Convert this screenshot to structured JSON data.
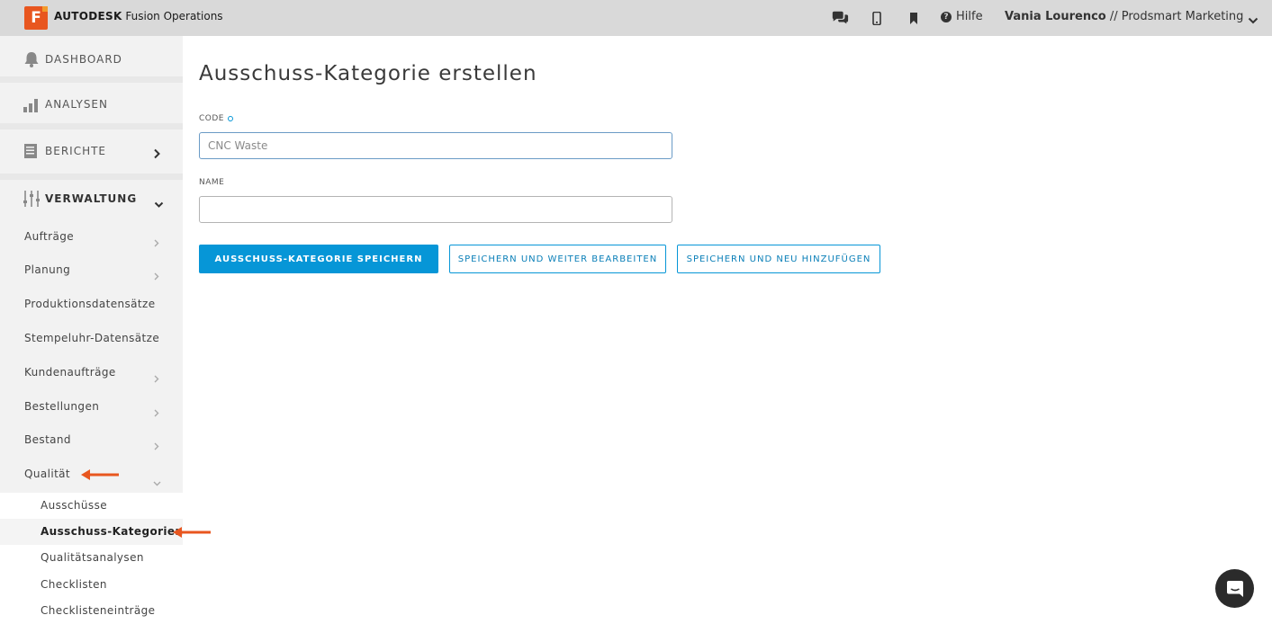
{
  "header": {
    "logo_letter": "F",
    "brand_strong": "AUTODESK",
    "brand_rest": " Fusion Operations",
    "icons": [
      "comments-icon",
      "mobile-icon",
      "bookmark-icon"
    ],
    "help_label": "Hilfe",
    "user_name": "Vania Lourenco",
    "user_separator": " // ",
    "user_company": "Prodsmart Marketing"
  },
  "sidebar": {
    "main_items": [
      {
        "label": "DASHBOARD",
        "icon": "bell-icon"
      },
      {
        "label": "ANALYSEN",
        "icon": "bar-chart-icon"
      },
      {
        "label": "BERICHTE",
        "icon": "report-icon"
      },
      {
        "label": "VERWALTUNG",
        "icon": "sliders-icon"
      }
    ],
    "sub_items": [
      {
        "label": "Aufträge"
      },
      {
        "label": "Planung"
      },
      {
        "label": "Produktionsdatensätze"
      },
      {
        "label": "Stempeluhr-Datensätze"
      },
      {
        "label": "Kundenaufträge"
      },
      {
        "label": "Bestellungen"
      },
      {
        "label": "Bestand"
      },
      {
        "label": "Qualität"
      }
    ],
    "quality_items": [
      {
        "label": "Ausschüsse"
      },
      {
        "label": "Ausschuss-Kategorien"
      },
      {
        "label": "Qualitätsanalysen"
      },
      {
        "label": "Checklisten"
      },
      {
        "label": "Checklisteneinträge"
      }
    ],
    "active_item": "Ausschuss-Kategorien"
  },
  "main": {
    "title": "Ausschuss-Kategorie erstellen",
    "code_label": "CODE",
    "code_value": "",
    "code_placeholder": "CNC Waste",
    "name_label": "NAME",
    "name_value": "",
    "buttons": {
      "save": "AUSSCHUSS-KATEGORIE SPEICHERN",
      "save_continue": "SPEICHERN UND WEITER BEARBEITEN",
      "save_add": "SPEICHERN UND NEU HINZUFÜGEN"
    }
  },
  "colors": {
    "accent": "#0696d7",
    "annotation_arrow": "#e8561f",
    "logo": "#e8561f"
  }
}
